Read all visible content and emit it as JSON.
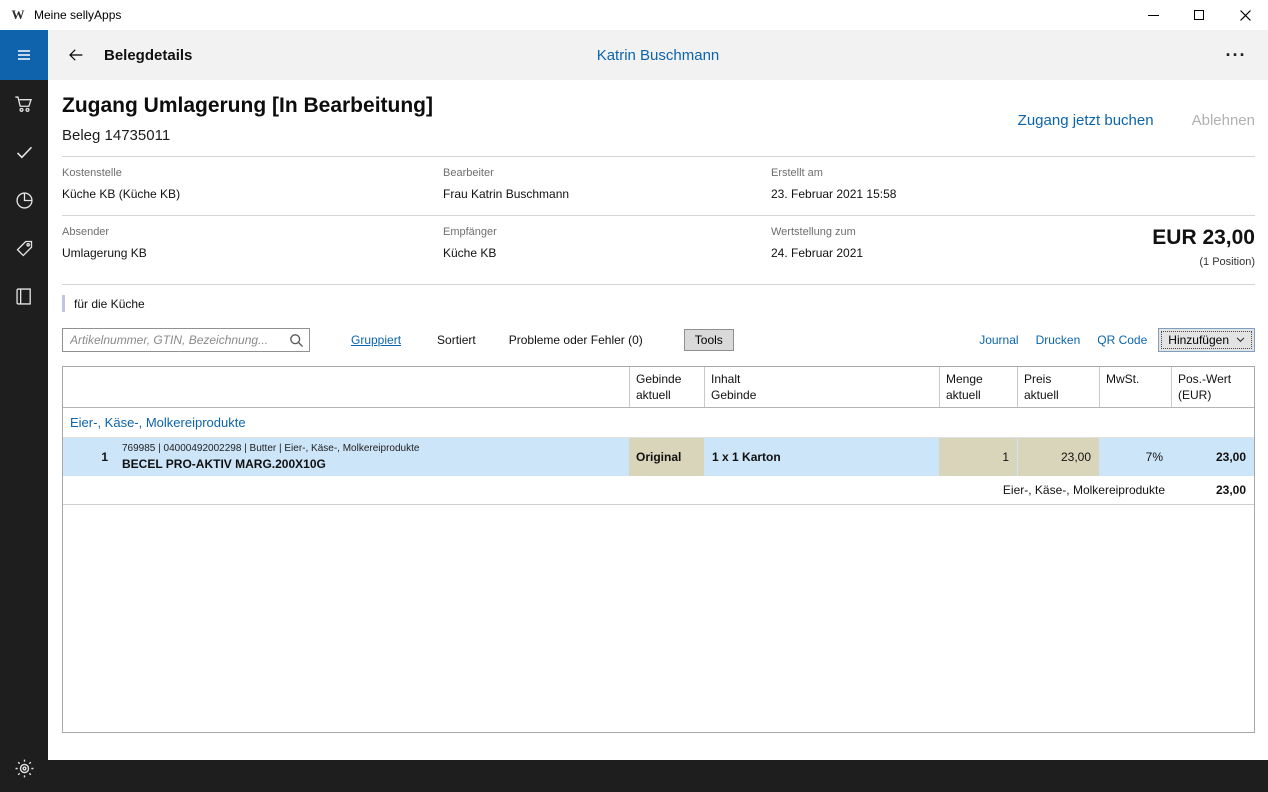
{
  "colors": {
    "accent": "#0c64ad",
    "sidebar_bg": "#1e1e1e",
    "hamburger_bg": "#0f62ac",
    "header_bg": "#f2f2f2",
    "row_highlight": "#cde5f8",
    "cell_editable": "#d8d5bb",
    "note_bar": "#c2c4e4"
  },
  "window": {
    "logo_glyph": "W",
    "title": "Meine sellyApps"
  },
  "header": {
    "title": "Belegdetails",
    "user": "Katrin Buschmann",
    "more": "···"
  },
  "doc": {
    "title": "Zugang Umlagerung [In Bearbeitung]",
    "subtitle": "Beleg 14735011",
    "action_book": "Zugang jetzt buchen",
    "action_reject": "Ablehnen",
    "fields_row1": [
      {
        "label": "Kostenstelle",
        "value": "Küche KB (Küche KB)"
      },
      {
        "label": "Bearbeiter",
        "value": "Frau Katrin Buschmann"
      },
      {
        "label": "Erstellt am",
        "value": "23. Februar 2021 15:58"
      }
    ],
    "fields_row2": [
      {
        "label": "Absender",
        "value": "Umlagerung KB"
      },
      {
        "label": "Empfänger",
        "value": "Küche KB"
      },
      {
        "label": "Wertstellung zum",
        "value": "24. Februar 2021"
      }
    ],
    "total_amount": "EUR 23,00",
    "total_positions": "(1 Position)",
    "note": "für die Küche"
  },
  "toolbar": {
    "search_placeholder": "Artikelnummer, GTIN, Bezeichnung...",
    "grouped": "Gruppiert",
    "sorted": "Sortiert",
    "problems": "Probleme oder Fehler (0)",
    "tools": "Tools",
    "journal": "Journal",
    "print": "Drucken",
    "qr": "QR Code",
    "add": "Hinzufügen"
  },
  "table": {
    "headers": {
      "gebinde": [
        "Gebinde",
        "aktuell"
      ],
      "inhalt": [
        "Inhalt",
        "Gebinde"
      ],
      "menge": [
        "Menge",
        "aktuell"
      ],
      "preis": [
        "Preis",
        "aktuell"
      ],
      "mwst": [
        "MwSt."
      ],
      "wert": [
        "Pos.-Wert",
        "(EUR)"
      ]
    },
    "group_title": "Eier-, Käse-, Molkereiprodukte",
    "rows": [
      {
        "pos": "1",
        "meta": "769985 | 04000492002298 | Butter | Eier-, Käse-, Molkereiprodukte",
        "name": "BECEL PRO-AKTIV MARG.200X10G",
        "gebinde": "Original",
        "inhalt": "1 x 1 Karton",
        "menge": "1",
        "preis": "23,00",
        "mwst": "7%",
        "wert": "23,00"
      }
    ],
    "summary_label": "Eier-, Käse-, Molkereiprodukte",
    "summary_value": "23,00"
  }
}
